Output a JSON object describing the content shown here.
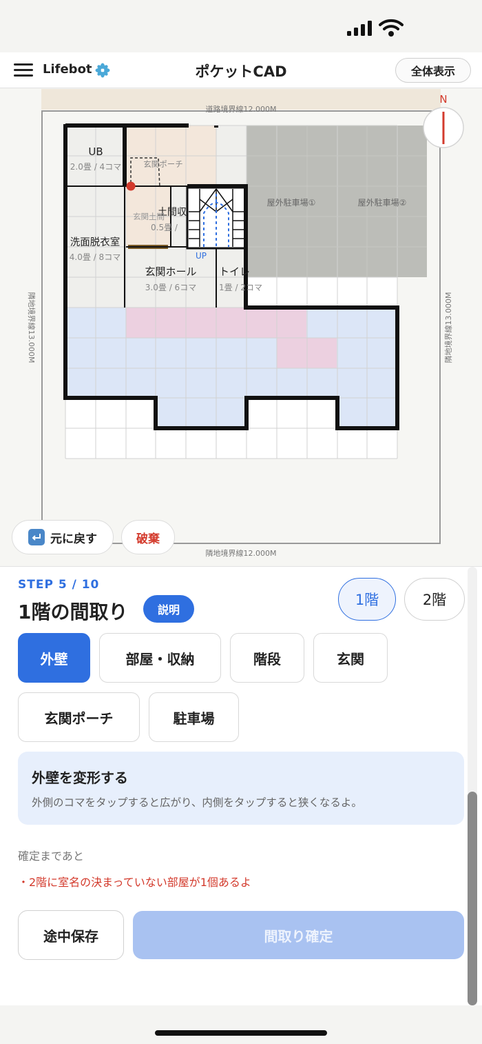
{
  "header": {
    "brand": "Lifebot",
    "title": "ポケットCAD",
    "fit_button": "全体表示"
  },
  "canvas": {
    "compass_label": "N",
    "boundary_top": "道路境界線12.000M",
    "boundary_bottom": "隣地境界線12.000M",
    "boundary_left": "隣地境界線13.000M",
    "boundary_right": "隣地境界線13.000M",
    "rooms": [
      {
        "name": "UB",
        "size": "2.0畳 / 4コマ"
      },
      {
        "name": "洗面脱衣室",
        "size": "4.0畳 / 8コマ"
      },
      {
        "name": "玄関ホール",
        "size": "3.0畳 / 6コマ"
      },
      {
        "name": "トイレ",
        "size": "1畳 / 2コマ"
      },
      {
        "name": "土間収",
        "size": "0.5畳 / "
      },
      {
        "name": "玄関ポーチ"
      },
      {
        "name": "玄関土間"
      },
      {
        "name": "屋外駐車場①"
      },
      {
        "name": "屋外駐車場②"
      }
    ],
    "stair_label": "UP",
    "undo_label": "元に戻す",
    "discard_label": "破棄",
    "colors": {
      "wall": "#111111",
      "floor_blue": "#dce6f7",
      "floor_pink": "#ecd0e0",
      "parking": "#bcbdb8",
      "porch": "#f3e7db",
      "room": "#efefec",
      "accent_red": "#d33a2c"
    }
  },
  "panel": {
    "step": "STEP 5 / 10",
    "title": "1階の間取り",
    "help_badge": "説明",
    "floor_tabs": [
      "1階",
      "2階"
    ],
    "tools": [
      "外壁",
      "部屋・収納",
      "階段",
      "玄関",
      "玄関ポーチ",
      "駐車場"
    ],
    "active_tool": "外壁",
    "info_title": "外壁を変形する",
    "info_desc": "外側のコマをタップすると広がり、内側をタップすると狭くなるよ。",
    "remaining_label": "確定まであと",
    "warning": "・2階に室名の決まっていない部屋が1個あるよ",
    "save_button": "途中保存",
    "confirm_button": "間取り確定"
  }
}
